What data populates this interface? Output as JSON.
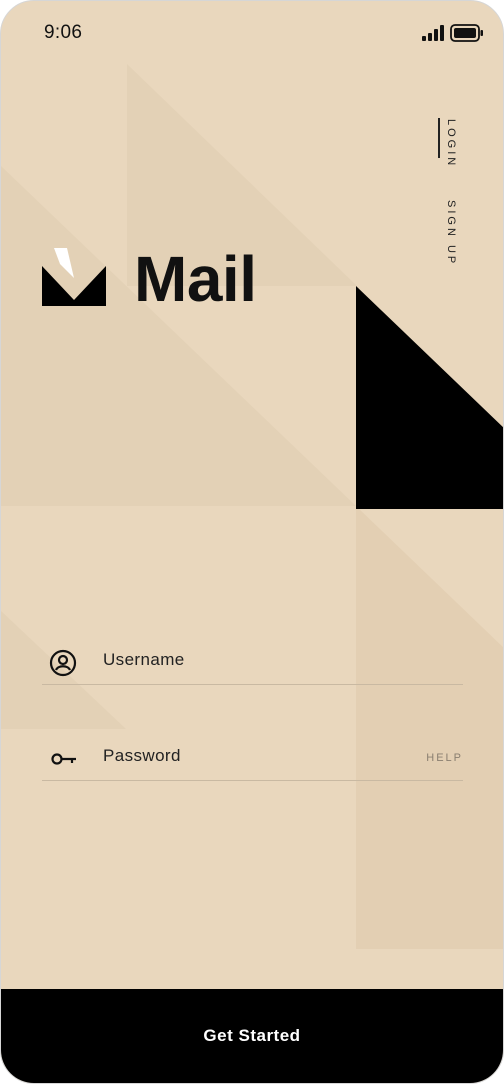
{
  "status_bar": {
    "time": "9:06"
  },
  "nav": {
    "login": "LOGIN",
    "signup": "SIGN UP"
  },
  "brand": {
    "name": "Mail"
  },
  "form": {
    "username_label": "Username",
    "password_label": "Password",
    "help_label": "HELP"
  },
  "cta": {
    "label": "Get Started"
  },
  "colors": {
    "background": "#e9d7bd",
    "shape": "#e2cfb4",
    "accent": "#000000"
  }
}
